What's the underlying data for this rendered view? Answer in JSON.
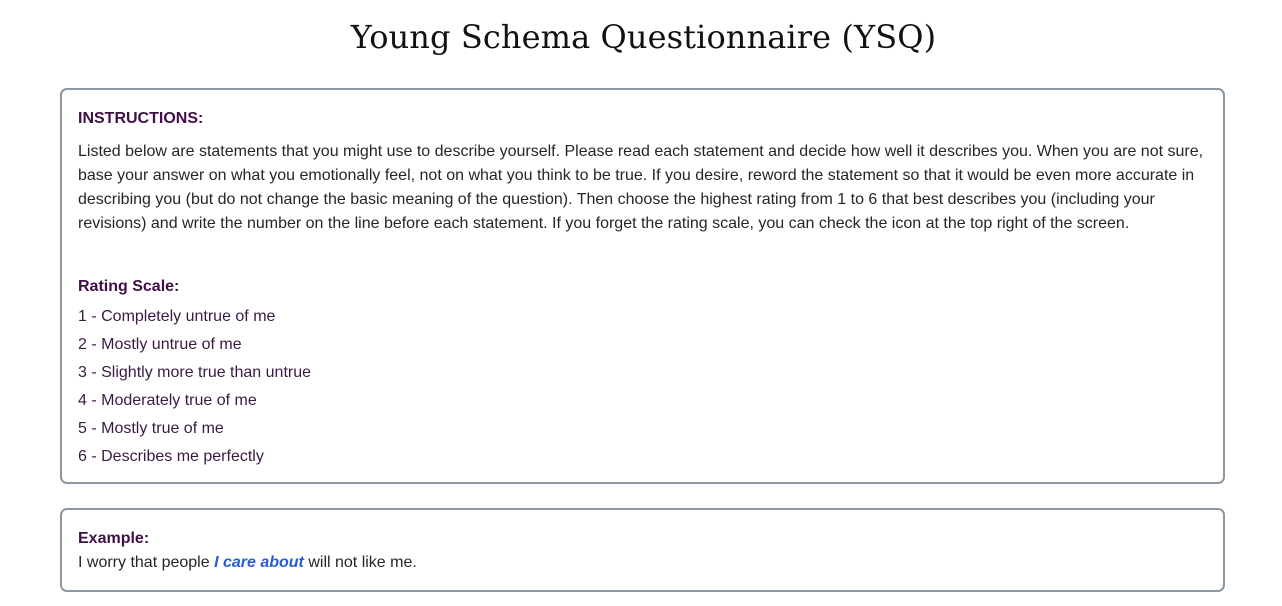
{
  "page": {
    "title": "Young Schema Questionnaire (YSQ)"
  },
  "instructions": {
    "heading": "INSTRUCTIONS:",
    "body": "Listed below are statements that you might use to describe yourself. Please read each statement and decide how well it describes you. When you are not sure, base your answer on what you emotionally feel, not on what you think to be true. If you desire, reword the statement so that it would be even more accurate in describing you (but do not change the basic meaning of the question). Then choose the highest rating from 1 to 6 that best describes you (including your revisions) and write the number on the line before each statement. If you forget the rating scale, you can check the icon at the top right of the screen."
  },
  "rating_scale": {
    "heading": "Rating Scale:",
    "items": [
      "1 - Completely untrue of me",
      "2 - Mostly untrue of me",
      "3 - Slightly more true than untrue",
      "4 - Moderately true of me",
      "5 - Mostly true of me",
      "6 - Describes me perfectly"
    ]
  },
  "example": {
    "heading": "Example:",
    "sentence_before": "I worry that people ",
    "sentence_highlight": "I care about",
    "sentence_after": " will not like me."
  },
  "colors": {
    "heading_text": "#3f0f45",
    "highlight": "#2a5bd7",
    "card_border": "#8d97a3"
  }
}
